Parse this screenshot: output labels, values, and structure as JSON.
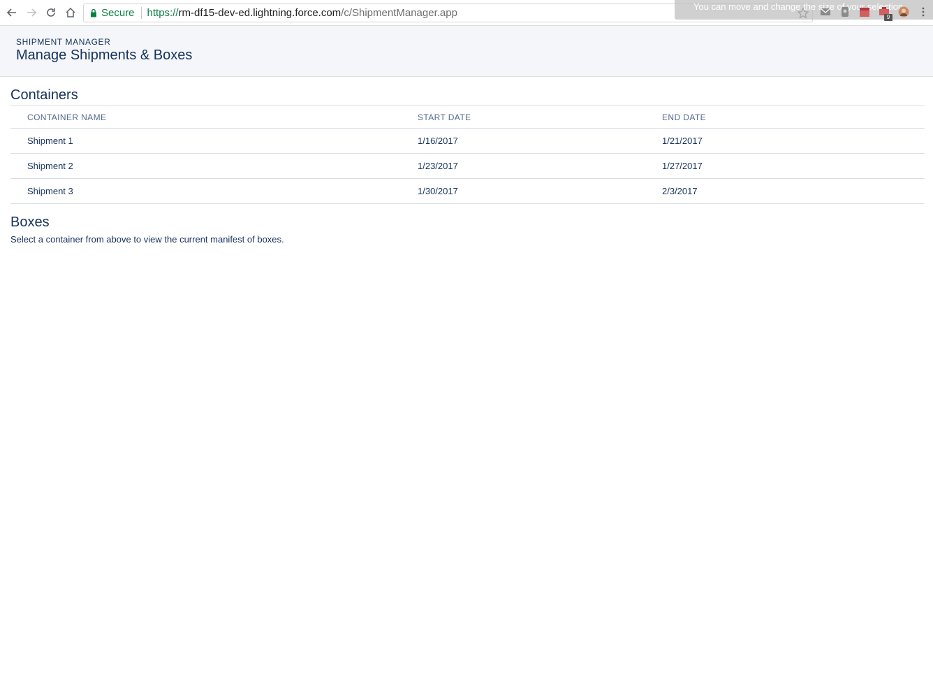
{
  "browser": {
    "secure_label": "Secure",
    "url": {
      "scheme": "https://",
      "host": "rm-df15-dev-ed.lightning.force.com",
      "path": "/c/ShipmentManager.app"
    },
    "overlay_tip": "You can move and change the size of your selection",
    "extension_badge": "9",
    "icons": [
      "back-icon",
      "forward-icon",
      "reload-icon",
      "home-icon",
      "lock-icon",
      "star-icon",
      "mail-icon",
      "extension-icon",
      "calendar-icon",
      "profile-icon",
      "menu-icon"
    ]
  },
  "header": {
    "kicker": "SHIPMENT MANAGER",
    "title": "Manage Shipments & Boxes"
  },
  "containers": {
    "title": "Containers",
    "columns": [
      "CONTAINER NAME",
      "START DATE",
      "END DATE"
    ],
    "rows": [
      {
        "name": "Shipment 1",
        "start": "1/16/2017",
        "end": "1/21/2017"
      },
      {
        "name": "Shipment 2",
        "start": "1/23/2017",
        "end": "1/27/2017"
      },
      {
        "name": "Shipment 3",
        "start": "1/30/2017",
        "end": "2/3/2017"
      }
    ]
  },
  "boxes": {
    "title": "Boxes",
    "help": "Select a container from above to view the current manifest of boxes."
  },
  "colors": {
    "header_bg": "#f4f6f9",
    "text": "#16325c",
    "label": "#54698d",
    "secure": "#0b8043",
    "border": "#d8dde6"
  }
}
